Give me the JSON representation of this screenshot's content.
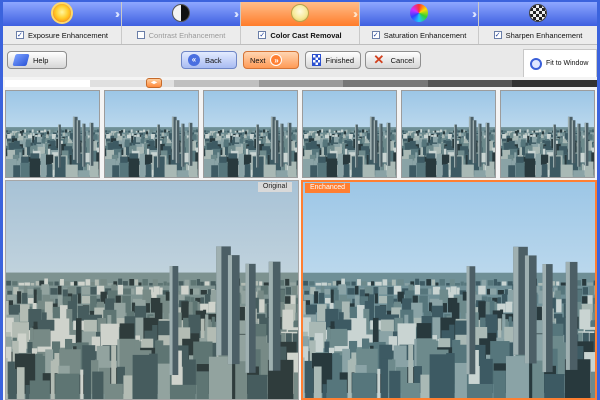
{
  "steps": [
    {
      "label": "Exposure Enhancement",
      "checked": true,
      "state": "done",
      "icon": "sun-icon"
    },
    {
      "label": "Contrast Enhancement",
      "checked": false,
      "state": "disabled",
      "icon": "contrast-icon"
    },
    {
      "label": "Color Cast Removal",
      "checked": true,
      "state": "active",
      "icon": "bulb-icon"
    },
    {
      "label": "Saturation Enhancement",
      "checked": true,
      "state": "pending",
      "icon": "color-sphere-icon"
    },
    {
      "label": "Sharpen Enhancement",
      "checked": true,
      "state": "pending",
      "icon": "checker-sphere-icon"
    }
  ],
  "toolbar": {
    "help_label": "Help",
    "back_label": "Back",
    "next_label": "Next",
    "finished_label": "Finished",
    "cancel_label": "Cancel",
    "fit_label": "Fit to Window"
  },
  "slider": {
    "segments": [
      "#ffffff",
      "#e0e0e0",
      "#c0c0c0",
      "#9a9a9a",
      "#777777",
      "#555555",
      "#333333"
    ],
    "thumb_glyph": "◂▸"
  },
  "thumbnails": {
    "count": 6
  },
  "panes": {
    "original_label": "Original",
    "enhanced_label": "Enchanced"
  },
  "colors": {
    "accent": "#ff7f32",
    "step_blue": "#3e5fe0",
    "frame_blue": "#3b63dd"
  }
}
